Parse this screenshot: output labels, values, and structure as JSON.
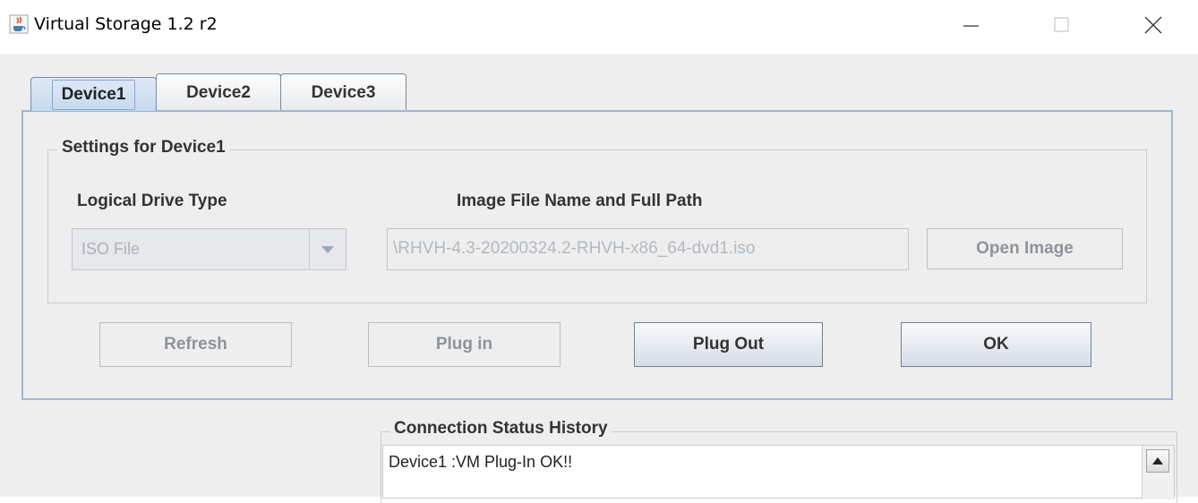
{
  "window": {
    "title": "Virtual Storage 1.2 r2",
    "icon": "java-cup-icon",
    "controls": [
      "minimize-icon",
      "maximize-icon",
      "close-icon"
    ]
  },
  "tabs": [
    {
      "label": "Device1",
      "active": true
    },
    {
      "label": "Device2",
      "active": false
    },
    {
      "label": "Device3",
      "active": false
    }
  ],
  "settings": {
    "group_title": "Settings for Device1",
    "drive_type_label": "Logical Drive Type",
    "drive_type_value": "ISO File",
    "image_path_label": "Image File Name and Full Path",
    "image_path_value": "\\RHVH-4.3-20200324.2-RHVH-x86_64-dvd1.iso",
    "open_image_button": "Open Image"
  },
  "actions": {
    "refresh": "Refresh",
    "plug_in": "Plug in",
    "plug_out": "Plug Out",
    "ok": "OK"
  },
  "status": {
    "title": "Connection Status History",
    "lines": [
      "Device1 :VM Plug-In OK!!"
    ]
  },
  "colors": {
    "active_tab": "#c7d9ef",
    "panel_border": "#9fb7d3",
    "disabled_text": "#8d949b"
  }
}
